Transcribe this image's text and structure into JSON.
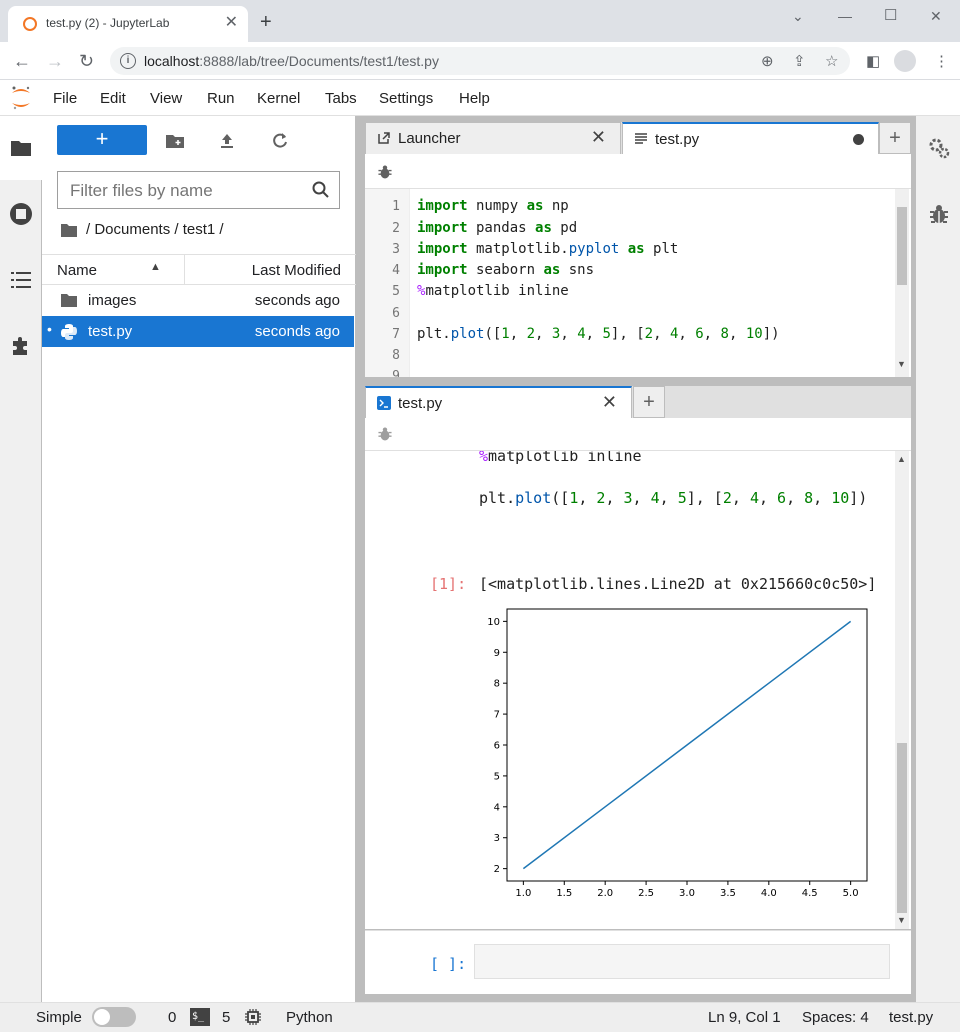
{
  "browser": {
    "tab_title": "test.py (2) - JupyterLab",
    "url_host": "localhost",
    "url_rest": ":8888/lab/tree/Documents/test1/test.py"
  },
  "menu": [
    "File",
    "Edit",
    "View",
    "Run",
    "Kernel",
    "Tabs",
    "Settings",
    "Help"
  ],
  "filebrowser": {
    "new_label": "+",
    "filter_placeholder": "Filter files by name",
    "breadcrumb": "/ Documents / test1 /",
    "col_name": "Name",
    "col_modified": "Last Modified",
    "rows": [
      {
        "name": "images",
        "modified": "seconds ago",
        "type": "folder"
      },
      {
        "name": "test.py",
        "modified": "seconds ago",
        "type": "python",
        "selected": true
      }
    ]
  },
  "editor": {
    "tabs": [
      {
        "label": "Launcher"
      },
      {
        "label": "test.py"
      }
    ],
    "line_numbers": [
      "1",
      "2",
      "3",
      "4",
      "5",
      "6",
      "7",
      "8",
      "9"
    ]
  },
  "console": {
    "tab_label": "test.py",
    "input_prompt": "[1]:",
    "output_text": "[<matplotlib.lines.Line2D at 0x215660c0c50>]",
    "empty_prompt": "[ ]:"
  },
  "status": {
    "mode_label": "Simple",
    "kernels_count": "0",
    "terminals_count": "5",
    "kernel_name": "Python",
    "cursor": "Ln 9, Col 1",
    "spaces": "Spaces: 4",
    "filename": "test.py"
  },
  "chart_data": {
    "type": "line",
    "x": [
      1.0,
      2.0,
      3.0,
      4.0,
      5.0
    ],
    "series": [
      {
        "values": [
          2,
          4,
          6,
          8,
          10
        ]
      }
    ],
    "xlim": [
      0.8,
      5.2
    ],
    "ylim": [
      1.6,
      10.4
    ],
    "xticks": [
      "1.0",
      "1.5",
      "2.0",
      "2.5",
      "3.0",
      "3.5",
      "4.0",
      "4.5",
      "5.0"
    ],
    "yticks": [
      "2",
      "3",
      "4",
      "5",
      "6",
      "7",
      "8",
      "9",
      "10"
    ],
    "color": "#1f77b4"
  }
}
